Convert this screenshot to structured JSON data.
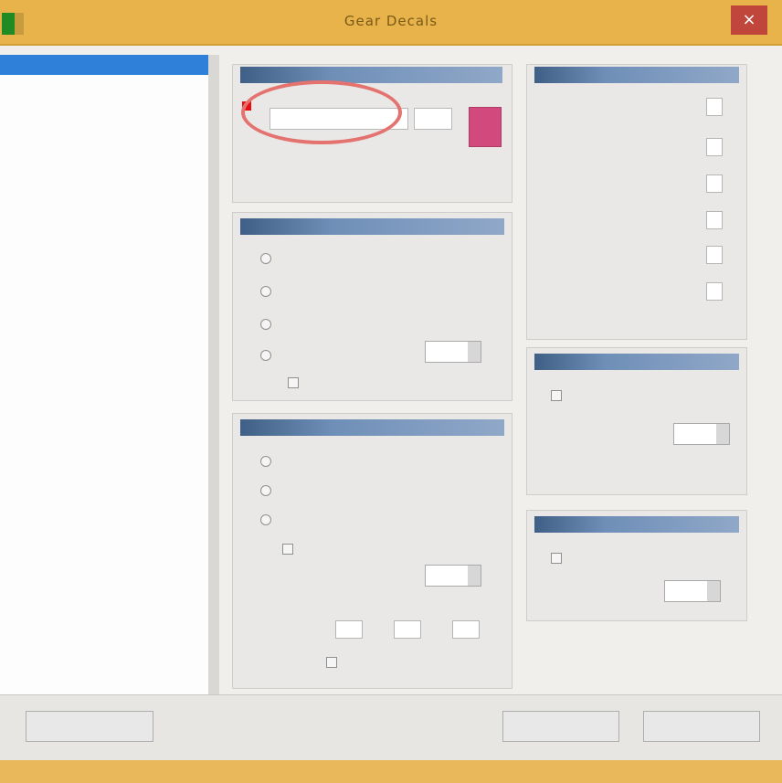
{
  "window": {
    "title": "Gear Decals",
    "close_glyph": "×"
  },
  "left_list": {
    "selected": "",
    "items": [
      "",
      "",
      "",
      "",
      "",
      "",
      "",
      "",
      "",
      "",
      "",
      "",
      "",
      "",
      ""
    ]
  },
  "panels": {
    "decal": {
      "header": "",
      "line1": "",
      "line2": ""
    },
    "mapping": {
      "header": "",
      "options": [
        "",
        "",
        "",
        ""
      ],
      "extra": ""
    },
    "lower": {
      "header": "",
      "options": [
        "",
        "",
        "",
        ""
      ],
      "footer": ""
    },
    "right_top": {
      "header": "",
      "rows": [
        "",
        "",
        "",
        "",
        "",
        ""
      ]
    },
    "right_mid": {
      "header": "",
      "checkbox": "",
      "row1": "",
      "row2": ""
    },
    "right_bottom": {
      "header": "",
      "checkbox": "",
      "row": ""
    }
  },
  "buttons": {
    "left": "",
    "center": "",
    "right": ""
  },
  "colors": {
    "titlebar": "#e7b34a",
    "selection": "#2f80d8",
    "panel_header": "#3f5f86",
    "swatch": "#d24a7d",
    "annotation": "#e4726f"
  }
}
